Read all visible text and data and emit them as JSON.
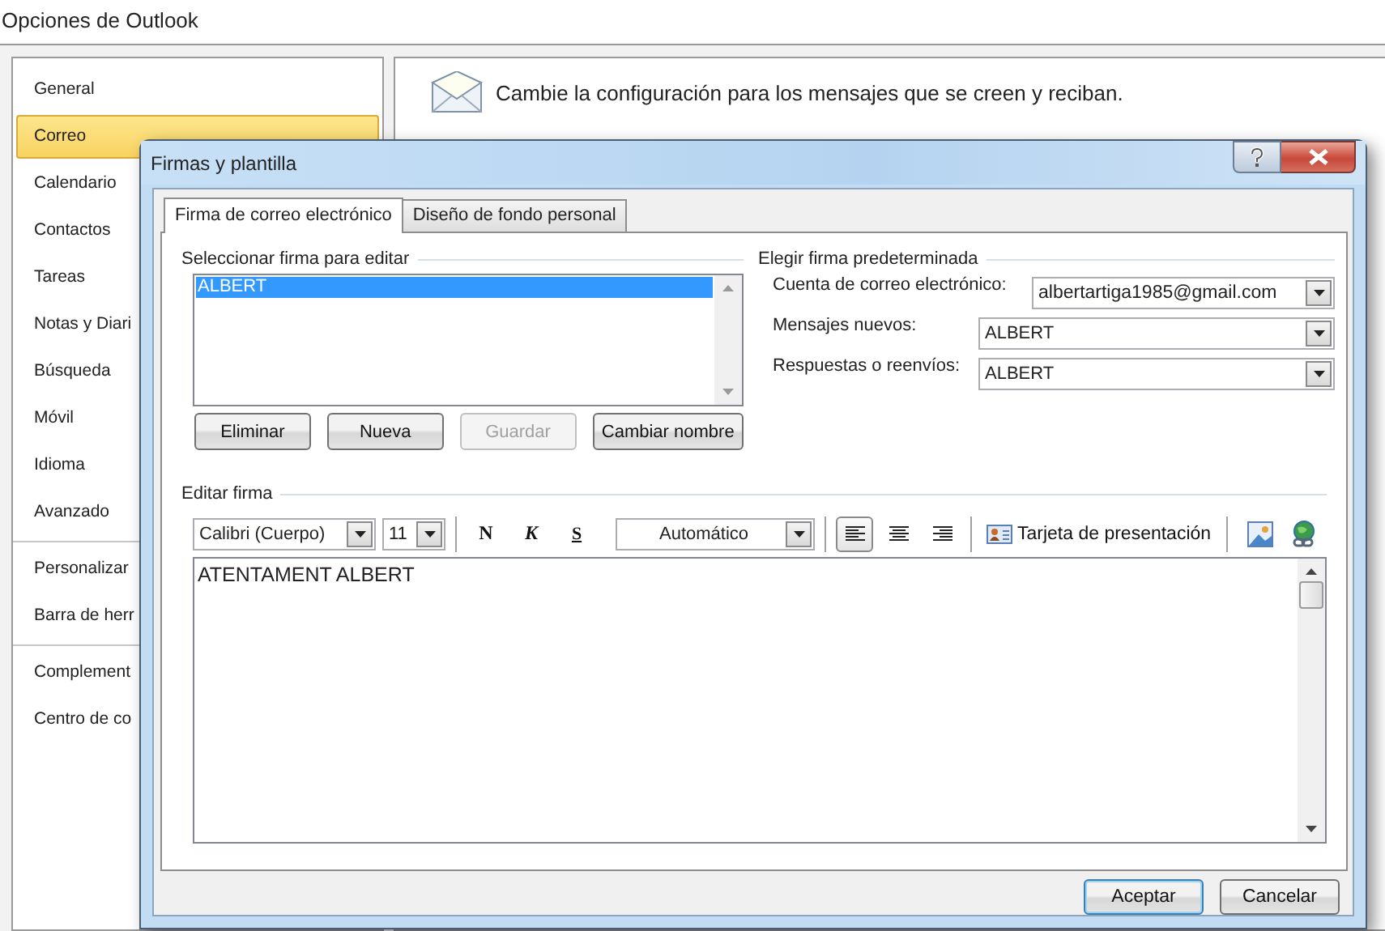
{
  "window": {
    "title": "Opciones de Outlook"
  },
  "sidebar": {
    "groups": [
      [
        {
          "label": "General",
          "selected": false
        },
        {
          "label": "Correo",
          "selected": true
        },
        {
          "label": "Calendario",
          "selected": false
        },
        {
          "label": "Contactos",
          "selected": false
        },
        {
          "label": "Tareas",
          "selected": false
        },
        {
          "label": "Notas y Diari",
          "selected": false
        },
        {
          "label": "Búsqueda",
          "selected": false
        },
        {
          "label": "Móvil",
          "selected": false
        },
        {
          "label": "Idioma",
          "selected": false
        },
        {
          "label": "Avanzado",
          "selected": false
        }
      ],
      [
        {
          "label": "Personalizar",
          "selected": false
        },
        {
          "label": "Barra de herr",
          "selected": false
        }
      ],
      [
        {
          "label": "Complement",
          "selected": false
        },
        {
          "label": "Centro de co",
          "selected": false
        }
      ]
    ]
  },
  "main": {
    "heading": "Cambie la configuración para los mensajes que se creen y reciban."
  },
  "dialog": {
    "title": "Firmas y plantilla",
    "tabs": [
      {
        "label": "Firma de correo electrónico",
        "selected": true
      },
      {
        "label": "Diseño de fondo personal",
        "selected": false
      }
    ],
    "select_section": {
      "label": "Seleccionar firma para editar",
      "signatures": [
        {
          "name": "ALBERT",
          "selected": true
        }
      ],
      "buttons": [
        {
          "label": "Eliminar",
          "disabled": false
        },
        {
          "label": "Nueva",
          "disabled": false
        },
        {
          "label": "Guardar",
          "disabled": true
        },
        {
          "label": "Cambiar nombre",
          "disabled": false
        }
      ]
    },
    "default_section": {
      "label": "Elegir firma predeterminada",
      "fields": [
        {
          "label": "Cuenta de correo electrónico:",
          "value": "albertartiga1985@gmail.com"
        },
        {
          "label": "Mensajes nuevos:",
          "value": "ALBERT"
        },
        {
          "label": "Respuestas o reenvíos:",
          "value": "ALBERT"
        }
      ]
    },
    "edit_section": {
      "label": "Editar firma",
      "font": "Calibri (Cuerpo)",
      "size": "11",
      "format_buttons": [
        {
          "label": "N",
          "kind": "bold"
        },
        {
          "label": "K",
          "kind": "italic"
        },
        {
          "label": "S",
          "kind": "underline"
        }
      ],
      "font_color_setting": "Automático",
      "alignments": [
        {
          "kind": "left",
          "selected": true
        },
        {
          "kind": "center",
          "selected": false
        },
        {
          "kind": "right",
          "selected": false
        }
      ],
      "business_card": "Tarjeta de presentación",
      "text": "ATENTAMENT ALBERT"
    },
    "buttons": [
      {
        "label": "Aceptar",
        "default": true
      },
      {
        "label": "Cancelar",
        "default": false
      }
    ]
  }
}
